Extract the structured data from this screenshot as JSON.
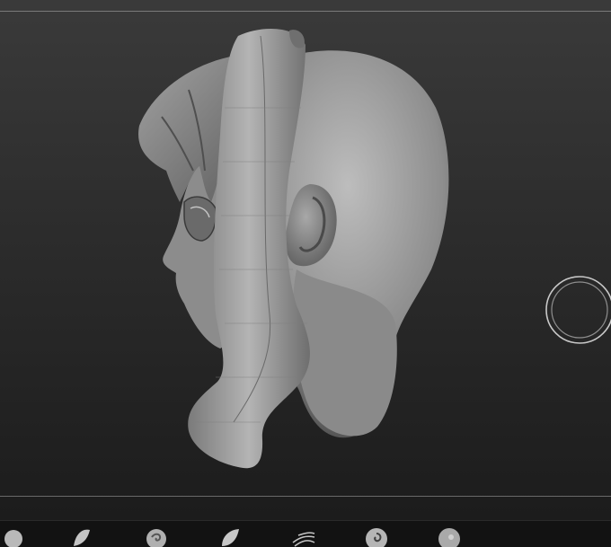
{
  "window": {
    "background": "#2c2c2c",
    "clay_color": "#9a9a9a"
  },
  "viewport": {
    "model_name": "",
    "view": "side-profile"
  },
  "navigation": {
    "icon": "rotate-gizmo-icon"
  },
  "brush_shelf": {
    "brushes": [
      {
        "icon": "clay-sphere-brush-icon"
      },
      {
        "icon": "horn-brush-icon"
      },
      {
        "icon": "spiral-brush-icon"
      },
      {
        "icon": "leaf-brush-icon"
      },
      {
        "icon": "fiber-brush-icon"
      },
      {
        "icon": "swirl-brush-icon"
      },
      {
        "icon": "sphere-inflate-brush-icon"
      }
    ]
  }
}
